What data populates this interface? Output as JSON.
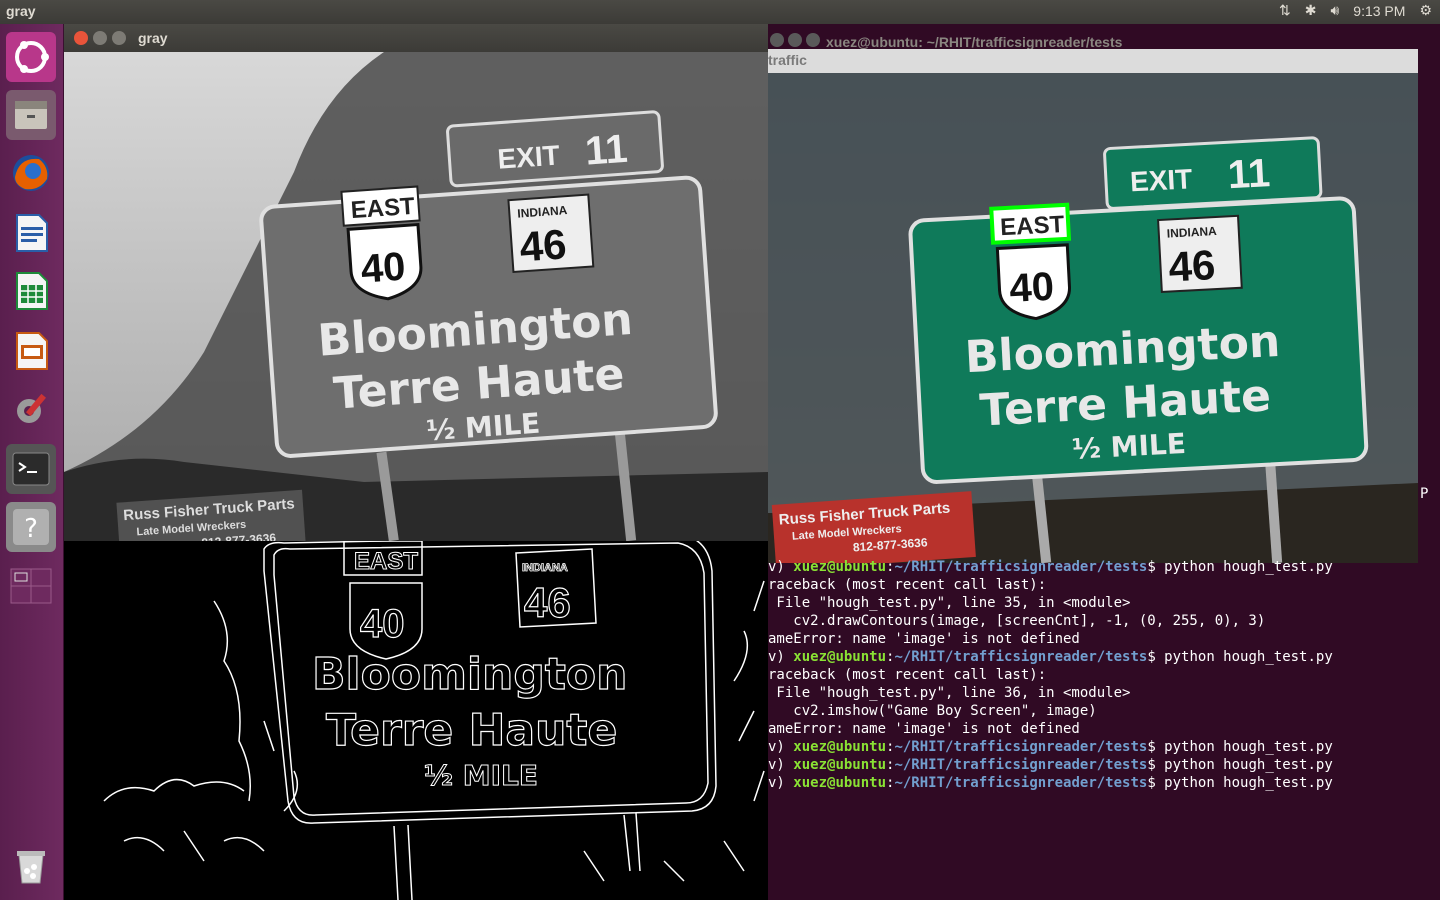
{
  "top_panel": {
    "app_title": "gray",
    "clock": "9:13 PM"
  },
  "launcher": {
    "items": [
      {
        "name": "ubuntu-dash-icon"
      },
      {
        "name": "files-icon"
      },
      {
        "name": "firefox-icon"
      },
      {
        "name": "writer-icon"
      },
      {
        "name": "calc-icon"
      },
      {
        "name": "impress-icon"
      },
      {
        "name": "settings-icon"
      },
      {
        "name": "terminal-icon"
      },
      {
        "name": "help-icon"
      },
      {
        "name": "workspace-switcher-icon"
      },
      {
        "name": "trash-icon"
      }
    ]
  },
  "gray_window": {
    "title": "gray",
    "sign": {
      "exit": "EXIT",
      "exit_num": "11",
      "east": "EAST",
      "us_route": "40",
      "state": "INDIANA",
      "state_route": "46",
      "line1": "Bloomington",
      "line2": "Terre Haute",
      "distance": "½ MILE",
      "billboard1": "Russ Fisher Truck Parts",
      "billboard2": "Late Model Wreckers",
      "billboard3": "812-877-3636"
    }
  },
  "terminal": {
    "title": "xuez@ubuntu: ~/RHIT/trafficsignreader/tests",
    "traffic_window_title": "traffic",
    "stray_char": "P",
    "lines": [
      {
        "type": "prompt",
        "prefix": "v) ",
        "user": "xuez@ubuntu",
        "sep": ":",
        "path": "~/RHIT/trafficsignreader/tests",
        "cmd": "$ python hough_test.py"
      },
      {
        "type": "text",
        "text": "raceback (most recent call last):"
      },
      {
        "type": "text",
        "text": " File \"hough_test.py\", line 35, in <module>"
      },
      {
        "type": "text",
        "text": "   cv2.drawContours(image, [screenCnt], -1, (0, 255, 0), 3)"
      },
      {
        "type": "text",
        "text": "ameError: name 'image' is not defined"
      },
      {
        "type": "prompt",
        "prefix": "v) ",
        "user": "xuez@ubuntu",
        "sep": ":",
        "path": "~/RHIT/trafficsignreader/tests",
        "cmd": "$ python hough_test.py"
      },
      {
        "type": "text",
        "text": "raceback (most recent call last):"
      },
      {
        "type": "text",
        "text": " File \"hough_test.py\", line 36, in <module>"
      },
      {
        "type": "text",
        "text": "   cv2.imshow(\"Game Boy Screen\", image)"
      },
      {
        "type": "text",
        "text": "ameError: name 'image' is not defined"
      },
      {
        "type": "prompt",
        "prefix": "v) ",
        "user": "xuez@ubuntu",
        "sep": ":",
        "path": "~/RHIT/trafficsignreader/tests",
        "cmd": "$ python hough_test.py"
      },
      {
        "type": "prompt",
        "prefix": "v) ",
        "user": "xuez@ubuntu",
        "sep": ":",
        "path": "~/RHIT/trafficsignreader/tests",
        "cmd": "$ python hough_test.py"
      },
      {
        "type": "prompt",
        "prefix": "v) ",
        "user": "xuez@ubuntu",
        "sep": ":",
        "path": "~/RHIT/trafficsignreader/tests",
        "cmd": "$ python hough_test.py"
      }
    ]
  },
  "colors": {
    "panel": "#3c3b37",
    "launcher": "#6e2a5f",
    "terminal_bg": "#300a24",
    "prompt_user": "#8ae234",
    "prompt_path": "#729fcf",
    "sign_green": "#0f7a5a",
    "contour_green": "#00ff00"
  }
}
